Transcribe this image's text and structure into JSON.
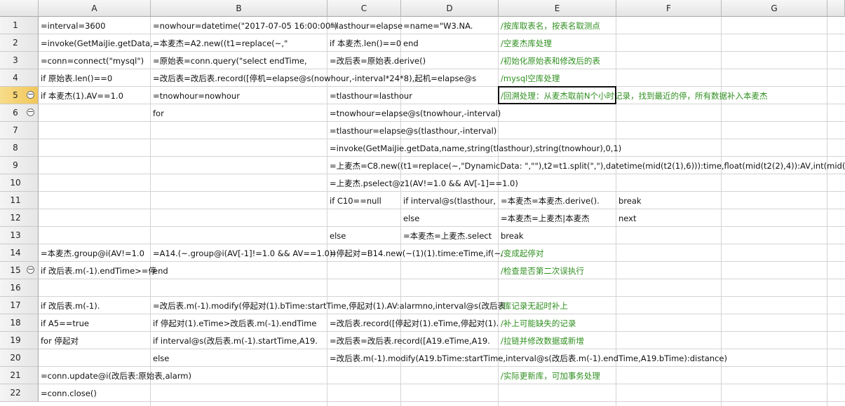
{
  "columns": [
    "A",
    "B",
    "C",
    "D",
    "E",
    "F",
    "G"
  ],
  "rows": [
    "1",
    "2",
    "3",
    "4",
    "5",
    "6",
    "7",
    "8",
    "9",
    "10",
    "11",
    "12",
    "13",
    "14",
    "15",
    "16",
    "17",
    "18",
    "19",
    "20",
    "21",
    "22"
  ],
  "selected_cell": "E5",
  "collapse_symbol": "−",
  "collapsed_rows": [
    "5",
    "6",
    "15"
  ],
  "note_color": "#2f8f1f",
  "cells": {
    "A1": "=interval=3600",
    "B1": "=nowhour=datetime(\"2017-07-05 16:00:00\")",
    "C1": "=lasthour=elapse",
    "D1": "=name=\"W3.NA.",
    "E1": "/按库取表名，按表名取测点",
    "A2": "=invoke(GetMaiJie.getData,",
    "B2": "=本麦杰=A2.new((t1=replace(~,\"",
    "C2": "if 本麦杰.len()==0",
    "D2": "end",
    "E2": "/空麦杰库处理",
    "A3": "=conn=connect(\"mysql\")",
    "B3": "=原始表=conn.query(\"select endTime,",
    "C3": "=改后表=原始表.derive()",
    "E3": "/初始化原始表和修改后的表",
    "A4": "if 原始表.len()==0",
    "B4": "=改后表=改后表.record([停机=elapse@s(nowhour,-interval*24*8),起机=elapse@s",
    "E4": "/mysql空库处理",
    "A5": "if 本麦杰(1).AV==1.0",
    "B5": "=tnowhour=nowhour",
    "C5": "=tlasthour=lasthour",
    "E5": "/回溯处理：从麦杰取前N个小时记录，找到最近的停，所有数据补入本麦杰",
    "B6": "for",
    "C6": "=tnowhour=elapse@s(tnowhour,-interval)",
    "C7": "=tlasthour=elapse@s(tlasthour,-interval)",
    "C8": "=invoke(GetMaiJie.getData,name,string(tlasthour),string(tnowhour),0,1)",
    "C9": "=上麦杰=C8.new((t1=replace(~,\"DynamicData: \",\"\"),t2=t1.split(\",\"),datetime(mid(t2(1),6))):time,float(mid(t2(2),4)):AV,int(mid(t2(3),4)):AS)",
    "C10": "=上麦杰.pselect@z1(AV!=1.0 && AV[-1]==1.0)",
    "C11": "if C10==null",
    "D11": "if interval@s(tlasthour,",
    "E11": "=本麦杰=本麦杰.derive().",
    "F11": "break",
    "D12": "else",
    "E12": "=本麦杰=上麦杰|本麦杰",
    "F12": "next",
    "C13": "else",
    "D13": "=本麦杰=上麦杰.select",
    "E13": "break",
    "A14": "=本麦杰.group@i(AV!=1.0",
    "B14": "=A14.(~.group@i(AV[-1]!=1.0 && AV==1.0))",
    "C14": "=停起对=B14.new(~(1)(1).time:eTime,if(~.",
    "E14": "/变成起停对",
    "A15": "if 改后表.m(-1).endTime>=停",
    "B15": "end",
    "E15": "/检查是否第二次误执行",
    "A17": "if 改后表.m(-1).",
    "B17": "=改后表.m(-1).modify(停起对(1).bTime:startTime,停起对(1).AV:alarmno,interval@s(改后表.",
    "E17": "/库记录无起时补上",
    "A18": "if A5==true",
    "B18": "if 停起对(1).eTime>改后表.m(-1).endTime",
    "C18": "=改后表.record([停起对(1).eTime,停起对(1).",
    "E18": "/补上可能缺失的记录",
    "A19": "for 停起对",
    "B19": "if interval@s(改后表.m(-1).startTime,A19.",
    "C19": "=改后表=改后表.record([A19.eTime,A19.",
    "E19": "/拉链并修改数据或新增",
    "B20": "else",
    "C20": "=改后表.m(-1).modify(A19.bTime:startTime,interval@s(改后表.m(-1).endTime,A19.bTime):distance)",
    "A21": "=conn.update@i(改后表:原始表,alarm)",
    "E21": "/实际更新库，可加事务处理",
    "A22": "=conn.close()"
  }
}
